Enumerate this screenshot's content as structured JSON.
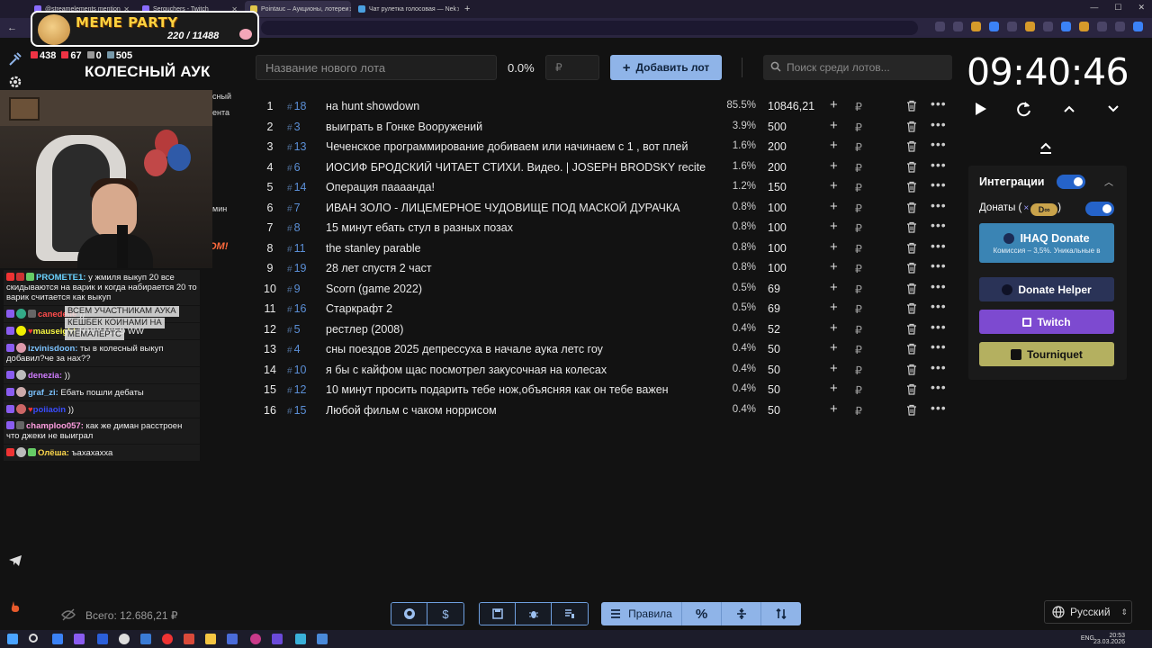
{
  "browser": {
    "tabs": [
      {
        "label": "@streamelements mention",
        "active": false
      },
      {
        "label": "Serguchers - Twitch",
        "active": false
      },
      {
        "label": "Pointauc – Аукционы, лотереи",
        "active": true
      },
      {
        "label": "Чат рулетка голосовая — Nek",
        "active": false
      }
    ]
  },
  "overlay": {
    "title": "MEME PARTY",
    "progress": "220 / 11488",
    "stats": {
      "live": "438",
      "lw": "67",
      "w": "0",
      "viewers": "505"
    },
    "heading": "КОЛЕСНЫЙ АУК",
    "side_fragments": [
      "сный",
      "ента",
      "мин",
      "OM!"
    ]
  },
  "chat": [
    {
      "name": "PROMETE1:",
      "name_color": "#6bd3ff",
      "text": " у жмиля выкуп 20 все скидываются на варик и когда набирается 20 то варик считается как выкуп"
    },
    {
      "name": "canedelle",
      "name_color": "#ff4c4c",
      "text": " ))"
    },
    {
      "name": "mauseight",
      "name_color": "#f5f542",
      "text": " TOOBASED WW"
    },
    {
      "name": "izvinisdoon:",
      "name_color": "#7cc3ff",
      "text": " ты в колесный выкуп добавил?че за нах??"
    },
    {
      "name": "denezia:",
      "name_color": "#d07cff",
      "text": " ))"
    },
    {
      "name": "graf_zi:",
      "name_color": "#7cc3ff",
      "text": " Ебать пошли дебаты"
    },
    {
      "name": "poiiaoin",
      "name_color": "#3a4cff",
      "text": " ))"
    },
    {
      "name": "champloo057:",
      "name_color": "#ff9de0",
      "text": " как же диман расстроен что джеки не выиграл"
    },
    {
      "name": "Олёша:",
      "name_color": "#ffd84c",
      "text": " ъахахахха"
    }
  ],
  "chat_popup": [
    "ВСЕМ УЧАСТНИКАМ АУКА",
    "КЕШБЕК КОИНАМИ НА",
    "МЕМАЛЕРТС"
  ],
  "form": {
    "lot_placeholder": "Название нового лота",
    "percent": "0.0%",
    "amount_placeholder": "₽",
    "add_label": "Добавить лот",
    "search_placeholder": "Поиск среди лотов..."
  },
  "lots": [
    {
      "index": "1",
      "id": "18",
      "name": "на hunt showdown",
      "percent": "85.5%",
      "amount": "10846,21"
    },
    {
      "index": "2",
      "id": "3",
      "name": "выиграть в Гонке Вооружений",
      "percent": "3.9%",
      "amount": "500"
    },
    {
      "index": "3",
      "id": "13",
      "name": " Чеченское программирование добиваем или начинаем с 1 , вот плей",
      "percent": "1.6%",
      "amount": "200"
    },
    {
      "index": "4",
      "id": "6",
      "name": "ИОСИФ БРОДСКИЙ ЧИТАЕТ СТИХИ. Видео. | JOSEPH BRODSKY recite",
      "percent": "1.6%",
      "amount": "200"
    },
    {
      "index": "5",
      "id": "14",
      "name": " Операция паааанда!",
      "percent": "1.2%",
      "amount": "150"
    },
    {
      "index": "6",
      "id": "7",
      "name": "ИВАН ЗОЛО - ЛИЦЕМЕРНОЕ ЧУДОВИЩЕ ПОД МАСКОЙ ДУРАЧКА",
      "percent": "0.8%",
      "amount": "100"
    },
    {
      "index": "7",
      "id": "8",
      "name": "15 минут ебать стул в разных позах",
      "percent": "0.8%",
      "amount": "100"
    },
    {
      "index": "8",
      "id": "11",
      "name": "the stanley parable",
      "percent": "0.8%",
      "amount": "100"
    },
    {
      "index": "9",
      "id": "19",
      "name": " 28 лет спустя 2 част",
      "percent": "0.8%",
      "amount": "100"
    },
    {
      "index": "10",
      "id": "9",
      "name": "Scorn (game 2022)",
      "percent": "0.5%",
      "amount": "69"
    },
    {
      "index": "11",
      "id": "16",
      "name": " Старкрафт 2",
      "percent": "0.5%",
      "amount": "69"
    },
    {
      "index": "12",
      "id": "5",
      "name": "рестлер (2008)",
      "percent": "0.4%",
      "amount": "52"
    },
    {
      "index": "13",
      "id": "4",
      "name": "сны поездов 2025 депрессуха в начале аука летс гоу",
      "percent": "0.4%",
      "amount": "50"
    },
    {
      "index": "14",
      "id": "10",
      "name": " я бы с кайфом щас посмотрел закусочная на колесах",
      "percent": "0.4%",
      "amount": "50"
    },
    {
      "index": "15",
      "id": "12",
      "name": " 10 минут просить подарить тебе нож,объясняя как он тебе важен",
      "percent": "0.4%",
      "amount": "50"
    },
    {
      "index": "16",
      "id": "15",
      "name": " Любой фильм с чаком норрисом",
      "percent": "0.4%",
      "amount": "50"
    }
  ],
  "lot_hash": "#",
  "lot_currency": "₽",
  "timer": "09:40:46",
  "integrations": {
    "title": "Интеграции",
    "donates_label": "Донаты (",
    "donates_close": ")",
    "donates_x": "×",
    "donates_logo": "D∞",
    "ihaq_label": "IHAQ Donate",
    "ihaq_sub": "Комиссия – 3,5%. Уникальные в",
    "dh_label": "Donate Helper",
    "twitch_label": "Twitch",
    "tourniquet_label": "Tourniquet"
  },
  "footer": {
    "total": "Всего: 12.686,21 ₽",
    "rules_label": "Правила",
    "language": "Русский"
  },
  "taskbar": {
    "lang": "ENG",
    "time": "20:53",
    "date": "23.03.2026"
  },
  "colors": {
    "accent_blue": "#8fb4e8",
    "id_blue": "#5b8fd6",
    "twitch": "#7d4ad0",
    "tourniquet": "#b4b060",
    "ihaq": "#3a84b4",
    "donate_helper": "#2a3357"
  }
}
